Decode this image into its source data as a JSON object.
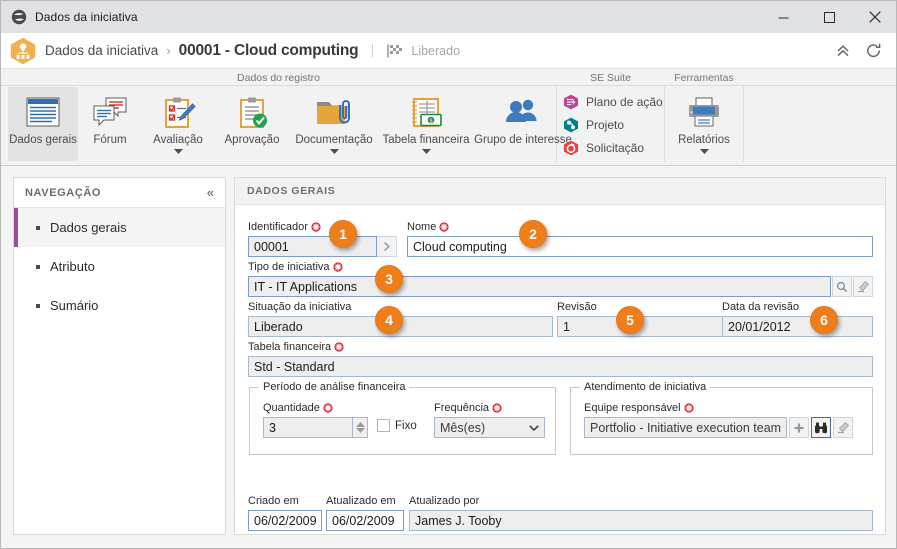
{
  "window": {
    "title": "Dados da iniciativa",
    "minimize_label": "Minimizar",
    "maximize_label": "Maximizar",
    "close_label": "Fechar"
  },
  "header": {
    "breadcrumb_root": "Dados da iniciativa",
    "breadcrumb_separator": "›",
    "record_title": "00001 - Cloud computing",
    "status": "Liberado",
    "collapse_label": "Recolher",
    "refresh_label": "Atualizar"
  },
  "ribbon": {
    "groups": [
      {
        "label": "Dados do registro"
      },
      {
        "label": "SE Suite"
      },
      {
        "label": "Ferramentas"
      }
    ],
    "record_items": [
      {
        "label": "Dados gerais",
        "icon": "window-lines-icon",
        "selected": true,
        "has_caret": false
      },
      {
        "label": "Fórum",
        "icon": "chat-bubbles-icon",
        "selected": false,
        "has_caret": false
      },
      {
        "label": "Avaliação",
        "icon": "clipboard-pencil-icon",
        "selected": false,
        "has_caret": true
      },
      {
        "label": "Aprovação",
        "icon": "clipboard-check-icon",
        "selected": false,
        "has_caret": false
      },
      {
        "label": "Documentação",
        "icon": "folder-clip-icon",
        "selected": false,
        "has_caret": true
      },
      {
        "label": "Tabela financeira",
        "icon": "ledger-money-icon",
        "selected": false,
        "has_caret": true
      },
      {
        "label": "Grupo de interesse",
        "icon": "users-group-icon",
        "selected": false,
        "has_caret": false
      }
    ],
    "se_suite_items": [
      {
        "label": "Plano de ação",
        "icon": "action-plan-icon",
        "color": "#b8478f"
      },
      {
        "label": "Projeto",
        "icon": "project-icon",
        "color": "#00818f"
      },
      {
        "label": "Solicitação",
        "icon": "request-icon",
        "color": "#e8413f"
      }
    ],
    "tools_items": [
      {
        "label": "Relatórios",
        "icon": "printer-icon",
        "has_caret": true
      }
    ]
  },
  "navigation": {
    "title": "NAVEGAÇÃO",
    "collapse_icon": "chevron-double-left-icon",
    "items": [
      {
        "label": "Dados gerais",
        "active": true
      },
      {
        "label": "Atributo",
        "active": false
      },
      {
        "label": "Sumário",
        "active": false
      }
    ]
  },
  "form": {
    "section_title": "DADOS GERAIS",
    "identificador": {
      "label": "Identificador",
      "value": "00001",
      "required": true,
      "next_button_icon": "chevron-right-icon"
    },
    "nome": {
      "label": "Nome",
      "value": "Cloud computing",
      "required": true
    },
    "tipo_iniciativa": {
      "label": "Tipo de iniciativa",
      "value": "IT - IT Applications",
      "required": true,
      "search_icon": "magnifier-icon",
      "clear_icon": "eraser-icon"
    },
    "situacao": {
      "label": "Situação da iniciativa",
      "value": "Liberado",
      "required": false
    },
    "revisao": {
      "label": "Revisão",
      "value": "1",
      "required": false
    },
    "data_revisao": {
      "label": "Data da revisão",
      "value": "20/01/2012",
      "required": false
    },
    "tabela_financeira": {
      "label": "Tabela financeira",
      "value": "Std - Standard",
      "required": true
    },
    "periodo_group": {
      "title": "Período de análise financeira",
      "quantidade": {
        "label": "Quantidade",
        "value": "3",
        "required": true
      },
      "fixo": {
        "label": "Fixo",
        "checked": false
      },
      "frequencia": {
        "label": "Frequência",
        "value": "Mês(es)",
        "required": true,
        "options": [
          "Mês(es)"
        ]
      }
    },
    "atendimento_group": {
      "title": "Atendimento de iniciativa",
      "equipe": {
        "label": "Equipe responsável",
        "value": "Portfolio - Initiative execution team",
        "required": true,
        "options": [
          "Portfolio - Initiative execution team"
        ],
        "add_icon": "plus-icon",
        "find_icon": "binoculars-icon",
        "clear_icon": "eraser-icon"
      }
    },
    "criado_em": {
      "label": "Criado em",
      "value": "06/02/2009"
    },
    "atualizado_em": {
      "label": "Atualizado em",
      "value": "06/02/2009"
    },
    "atualizado_por": {
      "label": "Atualizado por",
      "value": "James J. Tooby"
    }
  },
  "badges": [
    {
      "number": "1"
    },
    {
      "number": "2"
    },
    {
      "number": "3"
    },
    {
      "number": "4"
    },
    {
      "number": "5"
    },
    {
      "number": "6"
    }
  ],
  "colors": {
    "accent_orange": "#ef7d1a",
    "nav_active": "#9b4f96",
    "titlebar": "#dfe1e5",
    "required_marker": "#d62027"
  }
}
